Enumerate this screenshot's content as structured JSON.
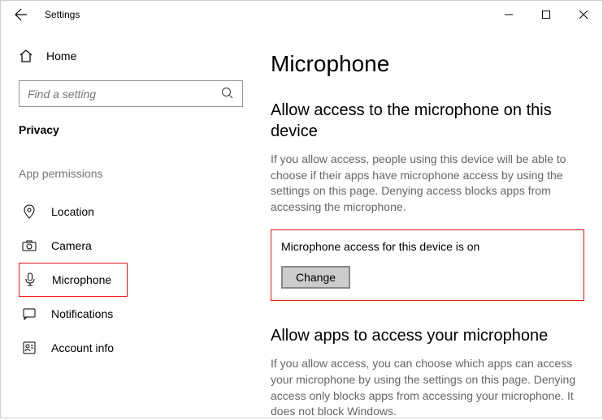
{
  "titlebar": {
    "title": "Settings"
  },
  "sidebar": {
    "home_label": "Home",
    "search_placeholder": "Find a setting",
    "section_title": "Privacy",
    "group_label": "App permissions",
    "items": {
      "location": "Location",
      "camera": "Camera",
      "microphone": "Microphone",
      "notifications": "Notifications",
      "account_info": "Account info"
    }
  },
  "content": {
    "heading": "Microphone",
    "section1": {
      "title": "Allow access to the microphone on this device",
      "desc": "If you allow access, people using this device will be able to choose if their apps have microphone access by using the settings on this page. Denying access blocks apps from accessing the microphone.",
      "status": "Microphone access for this device is on",
      "change_label": "Change"
    },
    "section2": {
      "title": "Allow apps to access your microphone",
      "desc": "If you allow access, you can choose which apps can access your microphone by using the settings on this page. Denying access only blocks apps from accessing your microphone. It does not block Windows."
    }
  }
}
